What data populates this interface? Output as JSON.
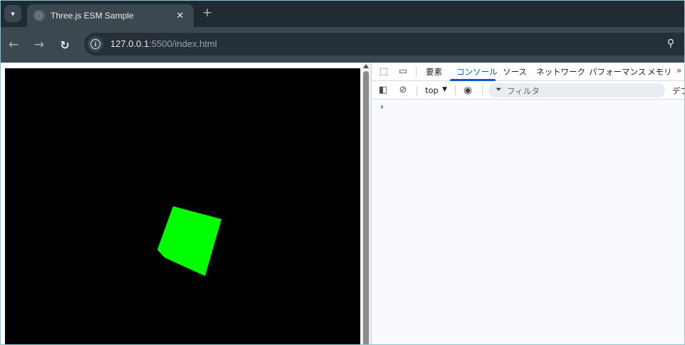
{
  "browser": {
    "tab": {
      "title": "Three.js ESM Sample"
    },
    "url": {
      "host": "127.0.0.1",
      "rest": ":5500/index.html"
    }
  },
  "page": {
    "background": "#ffffff",
    "canvas_background": "#000000",
    "cube_color": "#00ff00"
  },
  "devtools": {
    "tabs": [
      {
        "label": "要素"
      },
      {
        "label": "コンソール",
        "active": true
      },
      {
        "label": "ソース"
      },
      {
        "label": "ネットワーク"
      },
      {
        "label": "パフォーマンス"
      },
      {
        "label": "メモリ"
      }
    ],
    "more": "»",
    "console_bar": {
      "context": "top",
      "filter_placeholder": "フィルタ",
      "levels": "デフ"
    },
    "prompt": "›"
  }
}
